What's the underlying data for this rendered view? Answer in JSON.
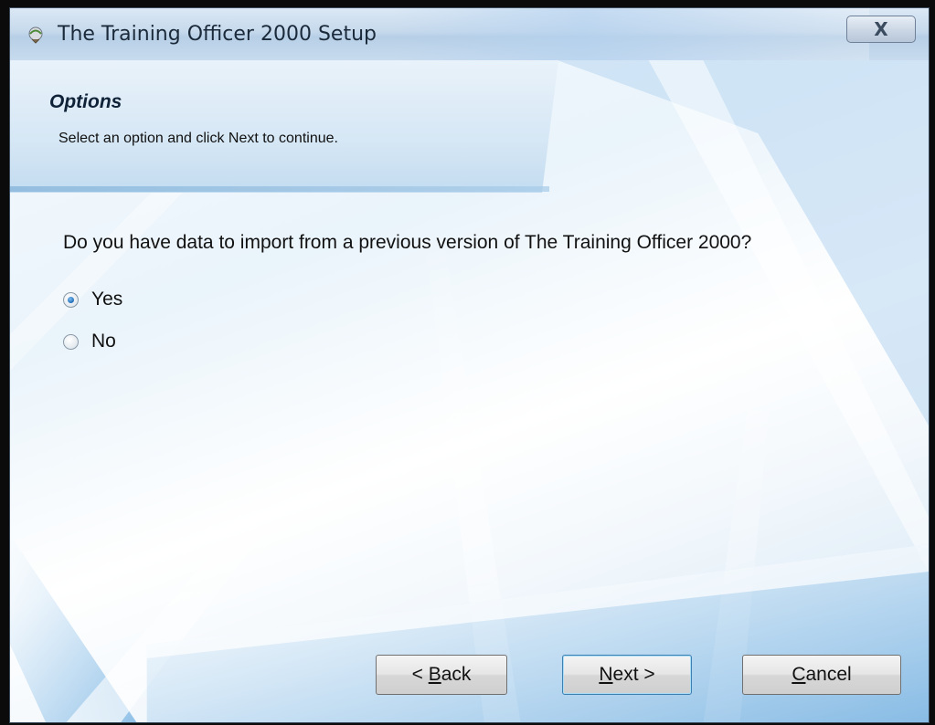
{
  "window": {
    "title": "The Training Officer 2000 Setup",
    "close_glyph": "X"
  },
  "header": {
    "title": "Options",
    "subtitle": "Select an option and click Next to continue."
  },
  "question": "Do you have data to import from a previous version of The Training Officer 2000?",
  "options": [
    {
      "label": "Yes",
      "selected": true
    },
    {
      "label": "No",
      "selected": false
    }
  ],
  "buttons": {
    "back_prefix": "< ",
    "back_mnemonic": "B",
    "back_rest": "ack",
    "next_mnemonic": "N",
    "next_rest": "ext >",
    "cancel_mnemonic": "C",
    "cancel_rest": "ancel"
  },
  "colors": {
    "accent": "#1f6cb8",
    "title_bar": "#c6d9ec"
  }
}
